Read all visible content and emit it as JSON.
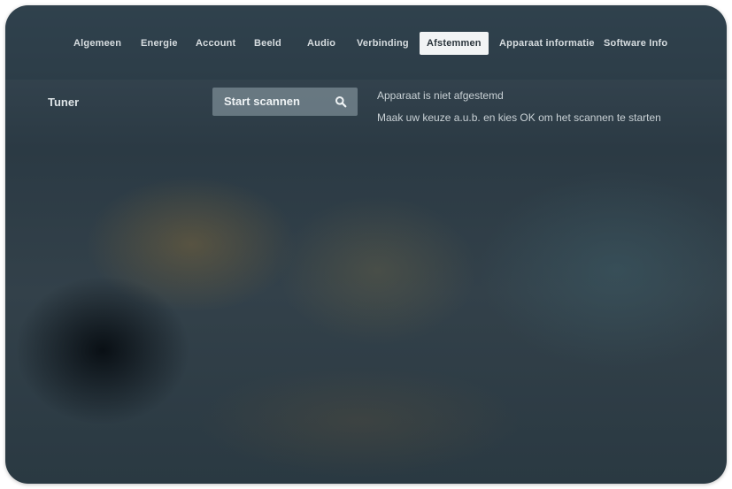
{
  "tabs": [
    {
      "label": "Algemeen",
      "active": false
    },
    {
      "label": "Energie",
      "active": false
    },
    {
      "label": "Account",
      "active": false
    },
    {
      "label": "Beeld",
      "active": false
    },
    {
      "label": "Audio",
      "active": false
    },
    {
      "label": "Verbinding",
      "active": false
    },
    {
      "label": "Afstemmen",
      "active": true
    },
    {
      "label": "Apparaat informatie",
      "active": false
    },
    {
      "label": "Software Info",
      "active": false
    }
  ],
  "tuner": {
    "label": "Tuner",
    "scan_button_label": "Start scannen",
    "scan_icon": "search-icon"
  },
  "status": {
    "line1": "Apparaat is niet afgestemd",
    "line2": "Maak uw keuze a.u.b. en kies OK om het scannen te starten"
  },
  "colors": {
    "active_tab_bg": "#f2f4f5",
    "active_tab_text": "#2a343b",
    "tab_text": "#d7dde0",
    "scan_button_bg": "#96a5af"
  }
}
